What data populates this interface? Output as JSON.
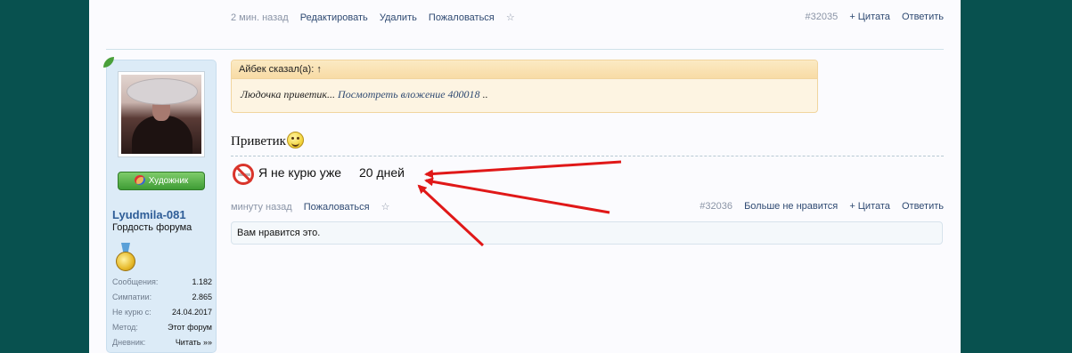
{
  "prev_post": {
    "time": "2 мин. назад",
    "actions": [
      "Редактировать",
      "Удалить",
      "Пожаловаться"
    ],
    "star": "☆",
    "post_number": "#32035",
    "quote_action": "+ Цитата",
    "reply_action": "Ответить"
  },
  "user": {
    "username": "Lyudmila-081",
    "title": "Гордость форума",
    "badge": "Художник",
    "stats": [
      {
        "label": "Сообщения:",
        "value": "1.182"
      },
      {
        "label": "Симпатии:",
        "value": "2.865"
      },
      {
        "label": "Не курю с:",
        "value": "24.04.2017"
      },
      {
        "label": "Метод:",
        "value": "Этот форум"
      },
      {
        "label": "Дневник:",
        "value": "Читать »»"
      }
    ]
  },
  "post": {
    "quote_header": "Айбек сказал(а): ↑",
    "quote_text": "Людочка приветик...",
    "quote_link": "Посмотреть вложение 400018",
    "quote_tail": " ..",
    "message": "Приветик",
    "signature_text": "Я не курю уже",
    "signature_days": "20 дней",
    "time": "минуту назад",
    "report": "Пожаловаться",
    "star": "☆",
    "post_number": "#32036",
    "unlike": "Больше не нравится",
    "quote_action": "+ Цитата",
    "reply_action": "Ответить",
    "likes_text": "Вам нравится это."
  },
  "colors": {
    "background": "#08514f",
    "page": "#fbfbfe",
    "link": "#2f4a72",
    "arrow": "#e01818"
  },
  "icons": {
    "smiley": "smiley-icon",
    "no_smoking": "no-smoking-icon",
    "medal": "medal-icon",
    "palette": "palette-icon"
  }
}
